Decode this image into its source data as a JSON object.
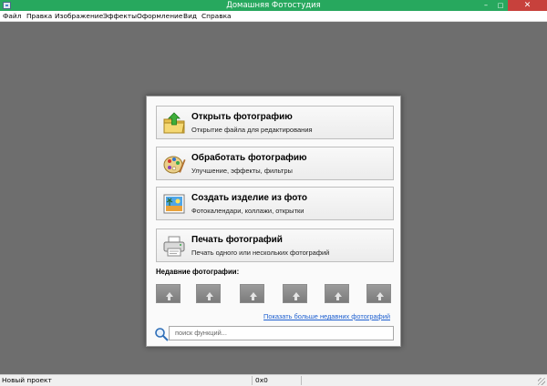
{
  "window": {
    "title": "Домашняя Фотостудия",
    "controls": {
      "minimize": "–",
      "maximize": "□",
      "close": "✕"
    }
  },
  "menu": [
    "Файл",
    "Правка",
    "Изображение",
    "Эффекты",
    "Оформление",
    "Вид",
    "Справка"
  ],
  "start_dialog": {
    "actions": [
      {
        "title": "Открыть фотографию",
        "subtitle": "Открытие файла для редактирования",
        "icon": "open-folder-icon"
      },
      {
        "title": "Обработать фотографию",
        "subtitle": "Улучшение, эффекты, фильтры",
        "icon": "palette-icon"
      },
      {
        "title": "Создать изделие из фото",
        "subtitle": "Фотокалендари, коллажи, открытки",
        "icon": "photo-product-icon"
      },
      {
        "title": "Печать фотографий",
        "subtitle": "Печать одного или нескольких фотографий",
        "icon": "printer-icon"
      }
    ],
    "recent": {
      "title": "Недавние фотографии:",
      "thumbnails": [
        "empty-thumbnail",
        "empty-thumbnail",
        "empty-thumbnail",
        "empty-thumbnail",
        "empty-thumbnail",
        "empty-thumbnail"
      ],
      "more_link": "Показать больше недавних фотографий"
    },
    "search": {
      "placeholder": "поиск функций...",
      "icon": "search-icon"
    }
  },
  "status": {
    "project": "Новый проект",
    "size": "0x0"
  },
  "colors": {
    "titlebar": "#27a85e",
    "close_button": "#c7413c",
    "workspace": "#6e6e6e",
    "link": "#1d5fd0"
  }
}
